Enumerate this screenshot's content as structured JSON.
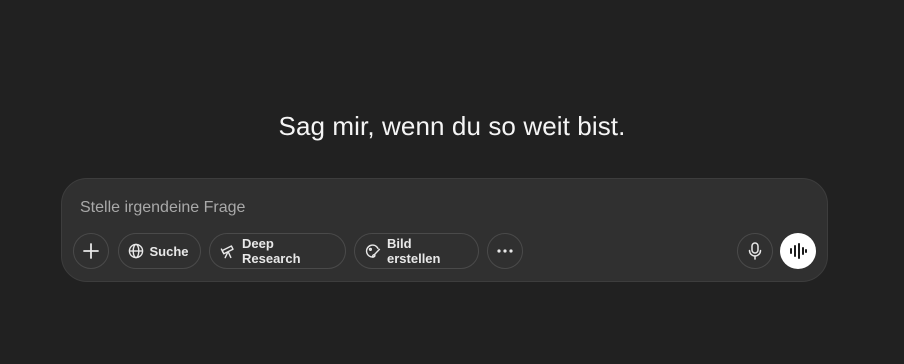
{
  "headline": "Sag mir, wenn du so weit bist.",
  "composer": {
    "placeholder": "Stelle irgendeine Frage",
    "buttons": {
      "search_label": "Suche",
      "deep_research_label": "Deep Research",
      "create_image_label": "Bild erstellen"
    }
  },
  "icons": {
    "plus": "plus-icon",
    "search": "globe-icon",
    "deep_research": "telescope-icon",
    "create_image": "image-brush-icon",
    "more": "more-dots-icon",
    "mic": "microphone-icon",
    "voice": "voice-waveform-icon"
  },
  "colors": {
    "background": "#212121",
    "composer": "#303030",
    "voice_button": "#ffffff"
  }
}
